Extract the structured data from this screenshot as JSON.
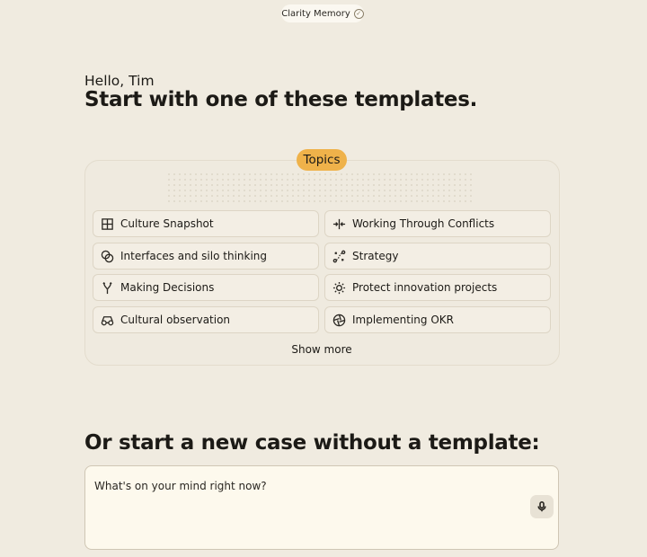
{
  "header": {
    "memory_label": "Clarity Memory",
    "memory_icon": "check-circle-icon"
  },
  "intro": {
    "greeting": "Hello, Tim",
    "headline": "Start with one of these templates."
  },
  "topics": {
    "badge_label": "Topics",
    "items": [
      {
        "label": "Culture Snapshot",
        "icon": "grid-icon"
      },
      {
        "label": "Working Through Conflicts",
        "icon": "converge-arrows-icon"
      },
      {
        "label": "Interfaces and silo thinking",
        "icon": "overlapping-circles-icon"
      },
      {
        "label": "Strategy",
        "icon": "strategy-path-icon"
      },
      {
        "label": "Making Decisions",
        "icon": "fork-icon"
      },
      {
        "label": "Protect innovation projects",
        "icon": "sunburst-icon"
      },
      {
        "label": "Cultural observation",
        "icon": "binoculars-icon"
      },
      {
        "label": "Implementing OKR",
        "icon": "aperture-icon"
      }
    ],
    "show_more_label": "Show more"
  },
  "new_case": {
    "heading": "Or start a new case without a template:",
    "placeholder": "What's on your mind right now?",
    "mic_icon": "microphone-icon"
  },
  "colors": {
    "background": "#f0ebe0",
    "accent_badge": "#efb24a",
    "input_bg": "#fdf9ed"
  }
}
